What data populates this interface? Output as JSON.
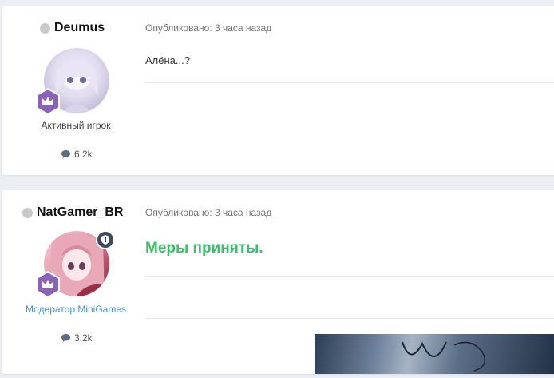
{
  "posts": [
    {
      "author": "Deumus",
      "group": "Активный игрок",
      "reputation": "6,2k",
      "meta": "Опубликовано: 3 часа назад",
      "content": "Алёна...?",
      "colors": {
        "group_title": "#444444"
      }
    },
    {
      "author": "NatGamer_BR",
      "group": "Модератор MiniGames",
      "reputation": "3,2k",
      "meta": "Опубликовано: 3 часа назад",
      "content": "Меры приняты.",
      "colors": {
        "group_title": "#4a8fd6",
        "content": "#3cbf6a"
      }
    }
  ]
}
